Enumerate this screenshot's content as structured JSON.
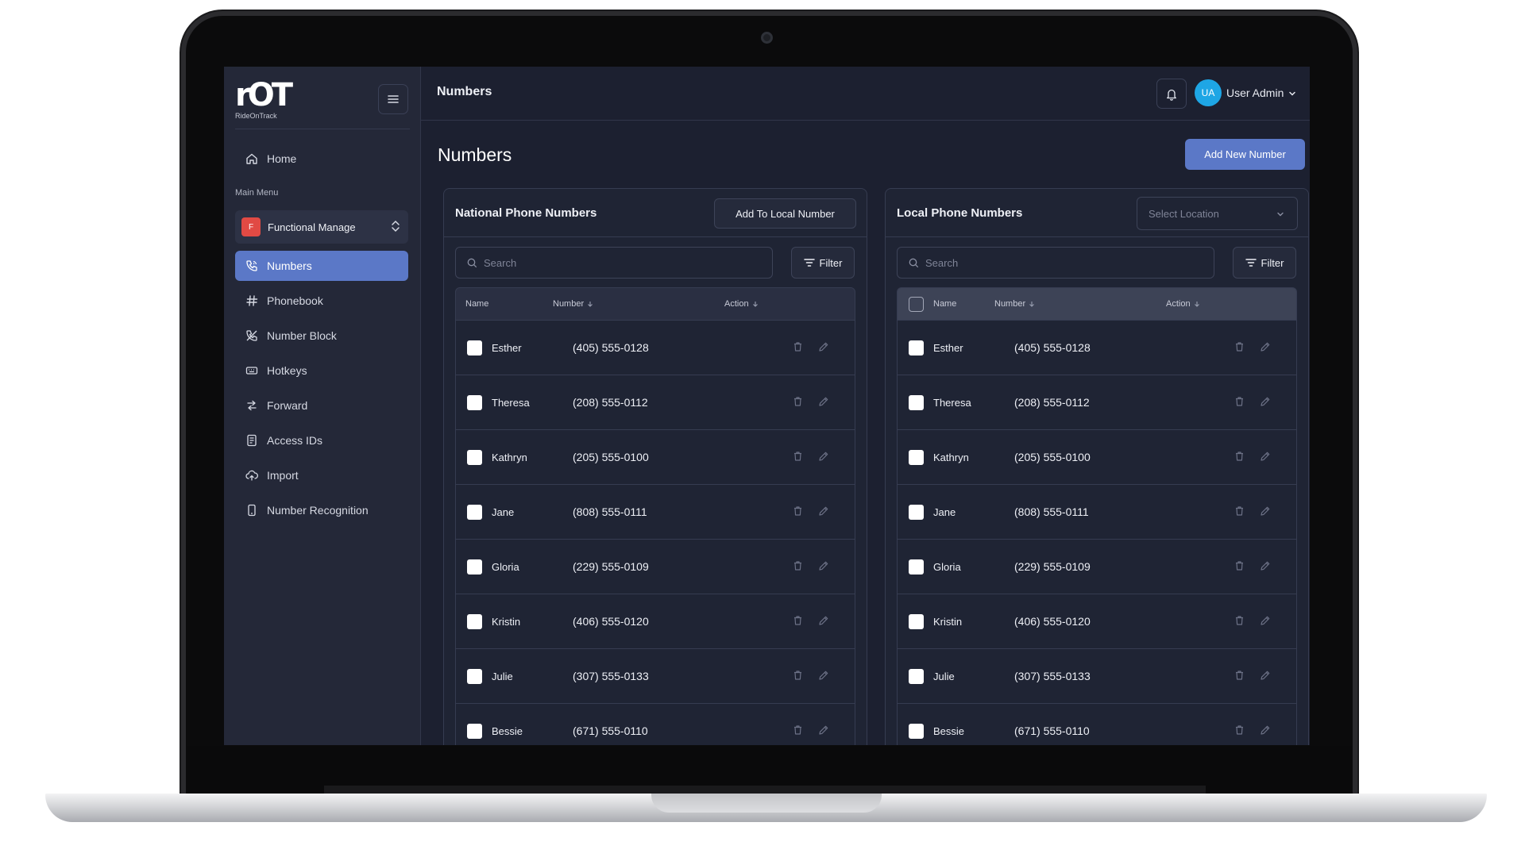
{
  "brand": {
    "logo_mark": "rOT",
    "logo_sub": "RideOnTrack"
  },
  "sidebar": {
    "home_label": "Home",
    "section_label": "Main Menu",
    "function_select": {
      "badge": "F",
      "label": "Functional Manage"
    },
    "items": [
      {
        "label": "Numbers",
        "icon": "phone-icon",
        "active": true
      },
      {
        "label": "Phonebook",
        "icon": "hash-icon"
      },
      {
        "label": "Number Block",
        "icon": "phone-off-icon"
      },
      {
        "label": "Hotkeys",
        "icon": "keyboard-icon"
      },
      {
        "label": "Forward",
        "icon": "forward-icon"
      },
      {
        "label": "Access IDs",
        "icon": "id-card-icon"
      },
      {
        "label": "Import",
        "icon": "cloud-upload-icon"
      },
      {
        "label": "Number Recognition",
        "icon": "mobile-icon"
      }
    ]
  },
  "topbar": {
    "title": "Numbers",
    "user_initials": "UA",
    "user_name": "User Admin"
  },
  "page": {
    "title": "Numbers",
    "add_button": "Add New Number"
  },
  "national": {
    "title": "National Phone Numbers",
    "action_button": "Add To Local Number",
    "search_placeholder": "Search",
    "filter_label": "Filter",
    "columns": [
      "Name",
      "Number",
      "Action"
    ],
    "rows": [
      {
        "name": "Esther",
        "number": "(405) 555-0128"
      },
      {
        "name": "Theresa",
        "number": "(208) 555-0112"
      },
      {
        "name": "Kathryn",
        "number": "(205) 555-0100"
      },
      {
        "name": "Jane",
        "number": "(808) 555-0111"
      },
      {
        "name": "Gloria",
        "number": "(229) 555-0109"
      },
      {
        "name": "Kristin",
        "number": "(406) 555-0120"
      },
      {
        "name": "Julie",
        "number": "(307) 555-0133"
      },
      {
        "name": "Bessie",
        "number": "(671) 555-0110"
      }
    ]
  },
  "local": {
    "title": "Local Phone Numbers",
    "select_placeholder": "Select Location",
    "search_placeholder": "Search",
    "filter_label": "Filter",
    "columns": [
      "Name",
      "Number",
      "Action"
    ],
    "rows": [
      {
        "name": "Esther",
        "number": "(405) 555-0128"
      },
      {
        "name": "Theresa",
        "number": "(208) 555-0112"
      },
      {
        "name": "Kathryn",
        "number": "(205) 555-0100"
      },
      {
        "name": "Jane",
        "number": "(808) 555-0111"
      },
      {
        "name": "Gloria",
        "number": "(229) 555-0109"
      },
      {
        "name": "Kristin",
        "number": "(406) 555-0120"
      },
      {
        "name": "Julie",
        "number": "(307) 555-0133"
      },
      {
        "name": "Bessie",
        "number": "(671) 555-0110"
      }
    ]
  },
  "colors": {
    "accent": "#5b78c7",
    "badge": "#e14a44",
    "avatar": "#1ea6e5",
    "background": "#1c2030"
  }
}
